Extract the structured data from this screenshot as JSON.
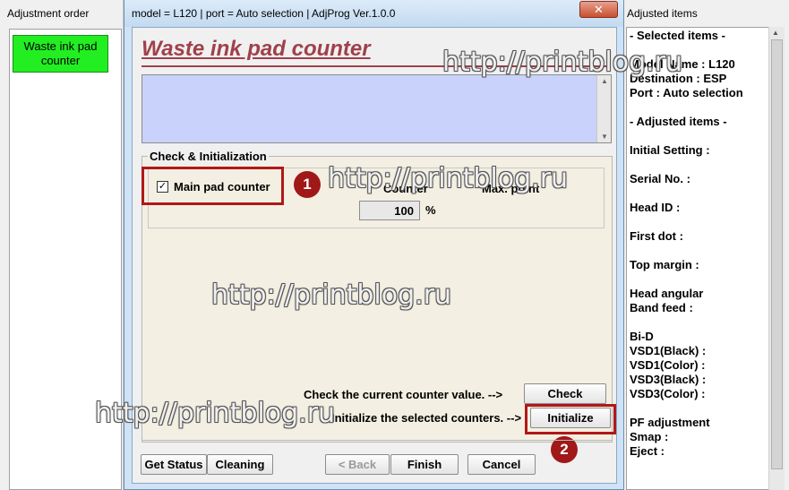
{
  "left_window": {
    "title": "Adjustment order",
    "waste_button_label": "Waste ink pad counter"
  },
  "right_window": {
    "title": "Adjusted items",
    "lines": [
      "- Selected items -",
      "Model Name : L120",
      "Destination : ESP",
      "Port : Auto selection",
      "- Adjusted items -",
      "Initial Setting :",
      "Serial No. :",
      "Head ID :",
      "First dot :",
      "Top margin :",
      "Head angular",
      " Band feed :",
      "Bi-D",
      " VSD1(Black) :",
      " VSD1(Color) :",
      " VSD3(Black) :",
      " VSD3(Color) :",
      "PF adjustment",
      "Smap :",
      "Eject :"
    ]
  },
  "dialog": {
    "title": "model = L120 | port = Auto selection | AdjProg Ver.1.0.0",
    "close_icon": "close-icon",
    "close_symbol": "✕",
    "heading": "Waste ink pad counter",
    "group_label": "Check & Initialization",
    "checkbox": {
      "label": "Main pad counter",
      "checked": true,
      "mark": "✓"
    },
    "columns": {
      "counter": "Counter",
      "limit": "Max. point"
    },
    "counter_value": "100",
    "percent_unit": "%",
    "check_label": "Check the current counter value. -->",
    "check_button": "Check",
    "init_label": "Initialize the selected counters. -->",
    "init_button": "Initialize",
    "buttons": {
      "get_status": "Get Status",
      "cleaning": "Cleaning",
      "back": "< Back",
      "finish": "Finish",
      "cancel": "Cancel"
    },
    "badges": [
      "1",
      "2"
    ],
    "highlight_color": "#b01818"
  },
  "watermark": "http://printblog.ru",
  "colors": {
    "heading": "#a0404a",
    "textarea": "#c8d2fa",
    "waste_button": "#22ee22",
    "group_bg": "#f3efe2"
  }
}
